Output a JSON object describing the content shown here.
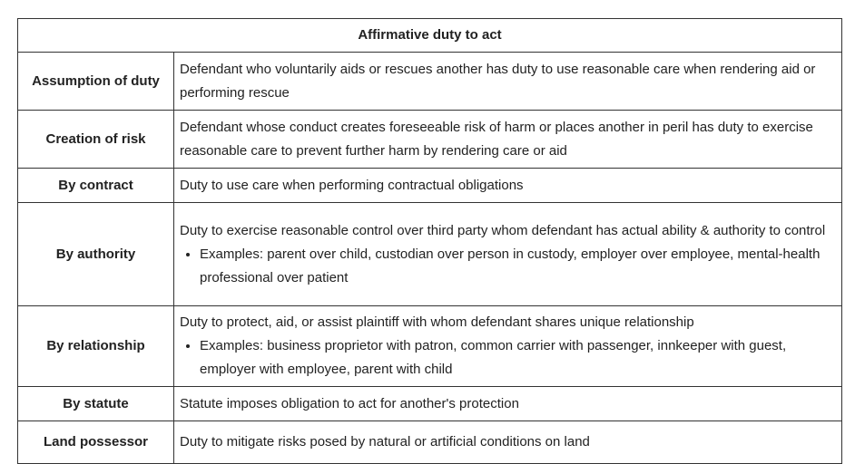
{
  "table": {
    "title": "Affirmative duty to act",
    "rows": [
      {
        "label": "Assumption of duty",
        "description": "Defendant who voluntarily aids or rescues another has duty to use reasonable care when rendering aid or performing rescue"
      },
      {
        "label": "Creation of risk",
        "description": "Defendant whose conduct creates foreseeable risk of harm or places another in peril has duty to exercise reasonable care to prevent further harm by rendering care or aid"
      },
      {
        "label": "By contract",
        "description": "Duty to use care when performing contractual obligations"
      },
      {
        "label": "By authority",
        "description": "Duty to exercise reasonable control over third party whom defendant has actual ability & authority to control",
        "example": "Examples:  parent over child, custodian over person in custody, employer over employee, mental-health professional over patient"
      },
      {
        "label": "By relationship",
        "description": "Duty to protect, aid, or assist plaintiff with whom defendant shares unique relationship",
        "example": "Examples:  business proprietor with patron, common carrier with passenger, innkeeper with guest, employer with employee, parent with child"
      },
      {
        "label": "By statute",
        "description": "Statute imposes obligation to act for another's protection"
      },
      {
        "label": "Land possessor",
        "description": "Duty to mitigate risks posed by natural or artificial conditions on land"
      }
    ]
  }
}
